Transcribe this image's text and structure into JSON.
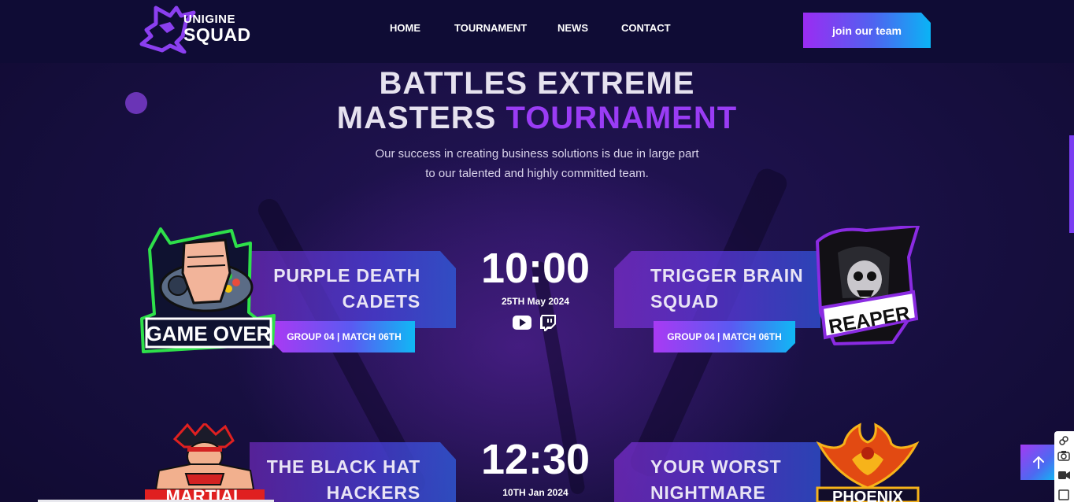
{
  "brand": {
    "top": "UNIGINE",
    "bottom": "SQUAD"
  },
  "nav": {
    "items": [
      "HOME",
      "TOURNAMENT",
      "NEWS",
      "CONTACT"
    ]
  },
  "header": {
    "cta_label": "join our team"
  },
  "hero": {
    "title_line1": "BATTLES EXTREME",
    "title_line2_plain": "MASTERS ",
    "title_line2_accent": "TOURNAMENT",
    "subtitle_line1": "Our success in creating business solutions is due in large part",
    "subtitle_line2": "to our talented and highly committed team."
  },
  "matches": [
    {
      "left_team": {
        "line1": "PURPLE DEATH",
        "line2": "CADETS",
        "logo_text": "GAME OVER",
        "logo_icon": "gamepad-fist-icon"
      },
      "left_group": "GROUP 04 | MATCH 06TH",
      "time": "10:00",
      "date": "25TH May 2024",
      "streams": [
        "youtube-icon",
        "twitch-icon"
      ],
      "right_team": {
        "line1": "TRIGGER BRAIN",
        "line2": "SQUAD",
        "logo_text": "REAPER",
        "logo_icon": "reaper-skull-icon"
      },
      "right_group": "GROUP 04 | MATCH 06TH"
    },
    {
      "left_team": {
        "line1": "THE BLACK HAT",
        "line2": "HACKERS",
        "logo_text": "MARTIAL",
        "logo_icon": "martial-fighter-icon"
      },
      "time": "12:30",
      "date": "10TH Jan 2024",
      "right_team": {
        "line1": "YOUR WORST",
        "line2": "NIGHTMARE",
        "logo_text": "PHOENIX",
        "logo_icon": "phoenix-bird-icon"
      }
    }
  ],
  "colors": {
    "background": "#150f3a",
    "header": "#0f0c35",
    "accent_purple": "#9a3cf5",
    "accent_blue": "#10b8f4"
  }
}
